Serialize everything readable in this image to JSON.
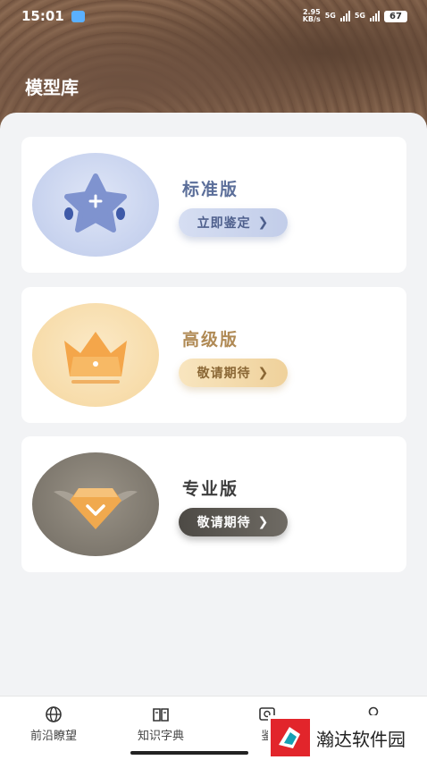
{
  "status_bar": {
    "time": "15:01",
    "net_speed_value": "2.95",
    "net_speed_unit": "KB/s",
    "network_1": "5G",
    "network_2": "5G",
    "battery": "67"
  },
  "header": {
    "title": "模型库"
  },
  "cards": [
    {
      "name": "标准版",
      "button": "立即鉴定",
      "icon": "star-icon",
      "name_color": "#5c6f9a",
      "button_color": "#4e5f8c"
    },
    {
      "name": "高级版",
      "button": "敬请期待",
      "icon": "crown-icon",
      "name_color": "#b08a55",
      "button_color": "#8a6735"
    },
    {
      "name": "专业版",
      "button": "敬请期待",
      "icon": "diamond-icon",
      "name_color": "#3d3d3d",
      "button_color": "#ffffff"
    }
  ],
  "tabbar": {
    "items": [
      {
        "label": "前沿瞭望",
        "icon": "globe-icon"
      },
      {
        "label": "知识字典",
        "icon": "book-icon"
      },
      {
        "label": "鉴",
        "icon": "scan-icon"
      },
      {
        "label": "",
        "icon": "profile-icon"
      }
    ]
  },
  "watermark": {
    "text": "瀚达软件园"
  }
}
